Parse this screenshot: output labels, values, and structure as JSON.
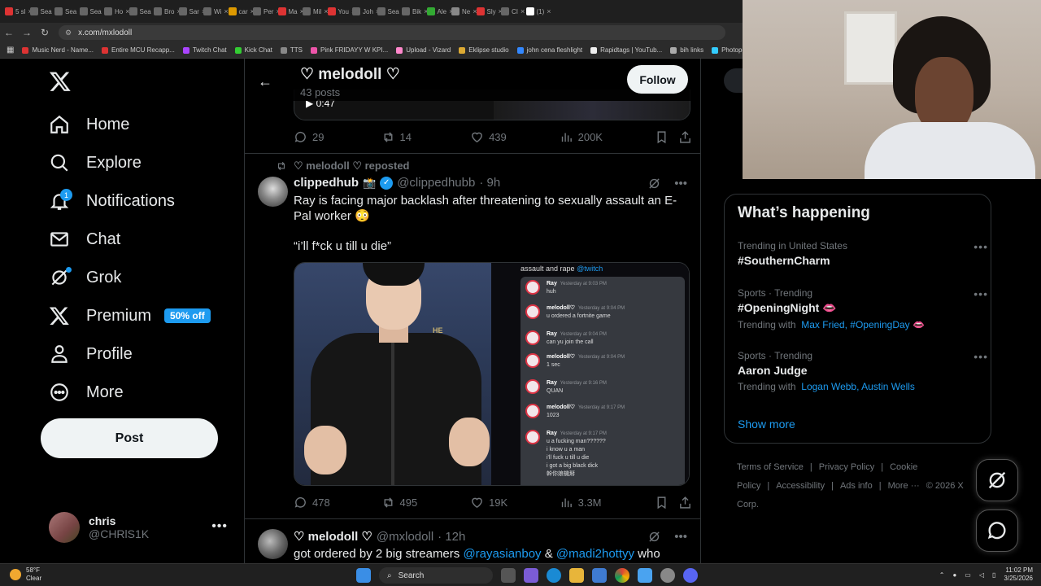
{
  "browser": {
    "tabs": [
      "5 sl",
      "Sea",
      "Sea",
      "Sea",
      "Ho",
      "Sea",
      "Bro",
      "Sar",
      "Wi",
      "car",
      "Per",
      "Ma",
      "Mil",
      "You",
      "Joh",
      "Sea",
      "Bik",
      "Ale",
      "Ne",
      "Sly",
      "CI",
      "(1)"
    ],
    "url": "x.com/mxlodoll",
    "bookmarks": [
      "Music Nerd - Name...",
      "Entire MCU Recapp...",
      "Twitch Chat",
      "Kick Chat",
      "TTS",
      "Pink FRIDAYY W KPI...",
      "Upload - Vizard",
      "Eklipse studio",
      "john cena fleshlight",
      "Rapidtags | YouTub...",
      "bih links",
      "Photopea"
    ]
  },
  "nav": {
    "home": "Home",
    "explore": "Explore",
    "notifications": "Notifications",
    "notifications_badge": "1",
    "chat": "Chat",
    "grok": "Grok",
    "premium": "Premium",
    "premium_badge": "50% off",
    "profile": "Profile",
    "more": "More",
    "post": "Post"
  },
  "account": {
    "name": "chris",
    "handle": "@CHRlS1K"
  },
  "header": {
    "title": "♡ melodoll ♡",
    "posts": "43 posts",
    "follow": "Follow"
  },
  "prev_tweet": {
    "duration": "0:47",
    "replies": "29",
    "reposts": "14",
    "likes": "439",
    "views": "200K"
  },
  "tweet1": {
    "repost_label": "♡ melodoll ♡ reposted",
    "name": "clippedhub",
    "name_emoji": "📸",
    "handle": "@clippedhubb",
    "time": "· 9h",
    "text1": "Ray is facing major backlash after threatening to sexually assault an E-Pal worker 😳",
    "text2": "“i’ll f*ck u till u die”",
    "replies": "478",
    "reposts": "495",
    "likes": "19K",
    "views": "3.3M",
    "image_caption": "assault and rape",
    "image_caption_tag": "@twitch",
    "jacket_text": "HE",
    "chat": [
      {
        "user": "Ray",
        "ts": "Yesterday at 9:03 PM",
        "text": "huh"
      },
      {
        "user": "melodoll♡",
        "ts": "Yesterday at 9:04 PM",
        "text": "u ordered a fortnite game"
      },
      {
        "user": "Ray",
        "ts": "Yesterday at 9:04 PM",
        "text": "can yu join the call"
      },
      {
        "user": "melodoll♡",
        "ts": "Yesterday at 9:04 PM",
        "text": "1 sec"
      },
      {
        "user": "Ray",
        "ts": "Yesterday at 9:16 PM",
        "text": "QUAN"
      },
      {
        "user": "melodoll♡",
        "ts": "Yesterday at 9:17 PM",
        "text": "1023"
      },
      {
        "user": "Ray",
        "ts": "Yesterday at 9:17 PM",
        "text": "u a fucking man??????\ni know u a man\ni'll fuck u till u die\ni got a big black dick\n幹你娘機掰"
      }
    ]
  },
  "tweet2": {
    "name": "♡ melodoll ♡",
    "handle": "@mxlodoll",
    "time": "· 12h",
    "text_a": "got ordered by 2 big streamers ",
    "mention1": "@rayasianboy",
    "amp": " & ",
    "mention2": "@madi2hottyy",
    "text_b": " who"
  },
  "sidebar": {
    "happening_title": "What’s happening",
    "trends": [
      {
        "meta": "Trending in United States",
        "topic": "#SouthernCharm",
        "with_label": "",
        "with": ""
      },
      {
        "meta": "Sports · Trending",
        "topic": "#OpeningNight 👄",
        "with_label": "Trending with",
        "with": "Max Fried, #OpeningDay 👄"
      },
      {
        "meta": "Sports · Trending",
        "topic": "Aaron Judge",
        "with_label": "Trending with",
        "with": "Logan Webb, Austin Wells"
      }
    ],
    "show_more": "Show more",
    "footer": [
      "Terms of Service",
      "|",
      "Privacy Policy",
      "|",
      "Cookie Policy",
      "|",
      "Accessibility",
      "|",
      "Ads info",
      "|",
      "More ···",
      "© 2026 X Corp."
    ]
  },
  "taskbar": {
    "temp": "58°F",
    "cond": "Clear",
    "search": "Search",
    "time": "11:02 PM",
    "date": "3/25/2026"
  },
  "colors": {
    "accent": "#1d9bf0",
    "bg": "#000000",
    "text": "#e7e9ea",
    "muted": "#71767b",
    "border": "#2f3336"
  }
}
